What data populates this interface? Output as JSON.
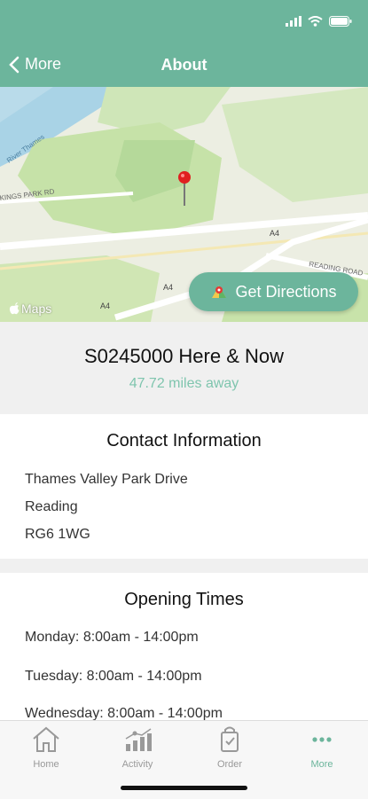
{
  "nav": {
    "back_label": "More",
    "title": "About"
  },
  "map": {
    "road_labels": [
      "A4",
      "A4",
      "A4",
      "READING ROAD",
      "KINGS PARK RD",
      "River Thames"
    ],
    "maps_label": "Maps",
    "directions_label": "Get Directions"
  },
  "store": {
    "name": "S0245000 Here & Now",
    "distance": "47.72 miles away"
  },
  "contact": {
    "title": "Contact Information",
    "address_line1": "Thames Valley Park Drive",
    "address_line2": "Reading",
    "postcode": "RG6 1WG"
  },
  "opening": {
    "title": "Opening Times",
    "days": [
      "Monday: 8:00am - 14:00pm",
      "Tuesday: 8:00am - 14:00pm",
      "Wednesday: 8:00am - 14:00pm"
    ]
  },
  "tabs": [
    {
      "label": "Home",
      "icon": "home-icon"
    },
    {
      "label": "Activity",
      "icon": "activity-icon"
    },
    {
      "label": "Order",
      "icon": "shopping-bag-icon"
    },
    {
      "label": "More",
      "icon": "more-icon"
    }
  ],
  "colors": {
    "accent": "#6cb59c",
    "distance": "#7fc5ae"
  }
}
